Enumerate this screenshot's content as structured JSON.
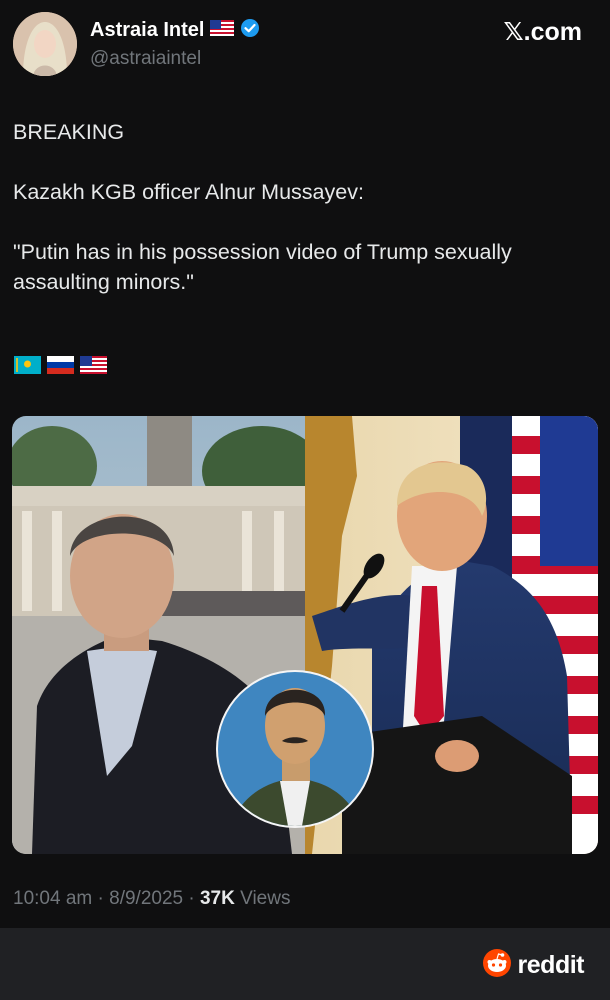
{
  "author": {
    "display_name": "Astraia Intel",
    "handle": "@astraiaintel",
    "flag_icon": "us-flag-icon",
    "verified_icon": "verified-badge-icon"
  },
  "site": "𝕏.com",
  "tweet": {
    "line1": "BREAKING",
    "line2": "Kazakh KGB officer Alnur Mussayev:",
    "line3": "\"Putin has in his possession video of Trump sexually assaulting minors.\"",
    "flags": [
      "kazakhstan-flag-icon",
      "russia-flag-icon",
      "us-flag-icon"
    ]
  },
  "media": {
    "left_photo": "man-in-dark-suit-outdoors",
    "right_photo": "man-at-podium-with-us-flags",
    "inset_photo": "man-in-military-uniform-portrait"
  },
  "meta": {
    "time": "10:04 am",
    "date": "8/9/2025",
    "views_count": "37K",
    "views_label": "Views"
  },
  "footer": {
    "brand": "reddit",
    "icon": "reddit-alien-icon"
  },
  "colors": {
    "background": "#0f0f10",
    "text": "#e7e9ea",
    "muted": "#71767b",
    "verified": "#1d9bf0",
    "reddit_orange": "#ff4500",
    "footer_bar": "#202124"
  }
}
